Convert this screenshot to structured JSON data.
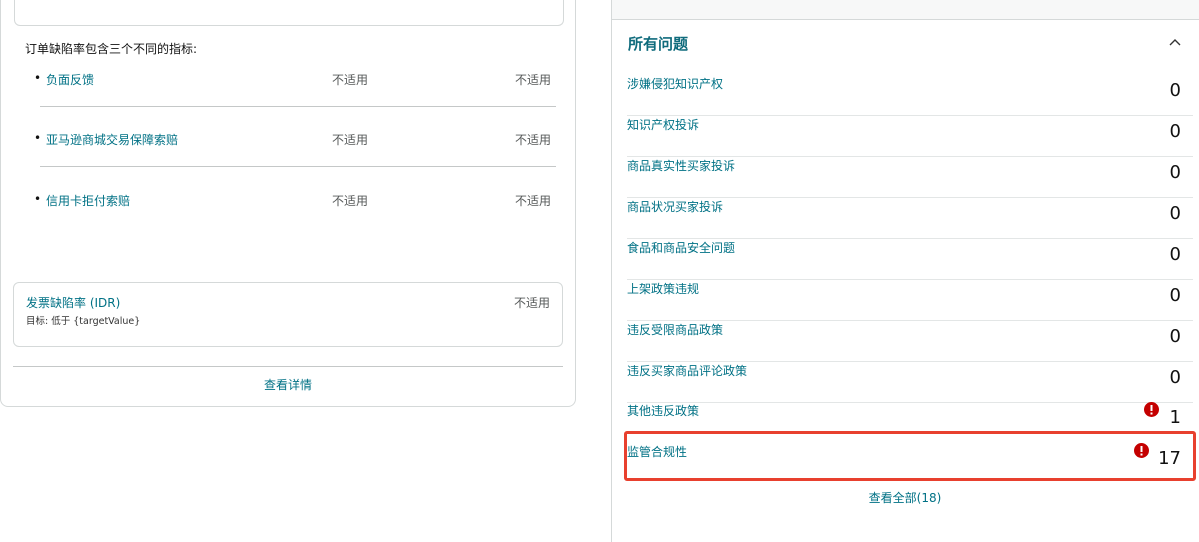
{
  "left": {
    "intro": "订单缺陷率包含三个不同的指标:",
    "metrics": [
      {
        "label": "负面反馈",
        "value1": "不适用",
        "value2": "不适用"
      },
      {
        "label": "亚马逊商城交易保障索赔",
        "value1": "不适用",
        "value2": "不适用"
      },
      {
        "label": "信用卡拒付索赔",
        "value1": "不适用",
        "value2": "不适用"
      }
    ],
    "idr": {
      "title": "发票缺陷率 (IDR)",
      "target": "目标: 低于 {targetValue}",
      "value": "不适用"
    },
    "view_details": "查看详情"
  },
  "right": {
    "title": "所有问题",
    "issues": [
      {
        "label": "涉嫌侵犯知识产权",
        "count": "0",
        "alert": false
      },
      {
        "label": "知识产权投诉",
        "count": "0",
        "alert": false
      },
      {
        "label": "商品真实性买家投诉",
        "count": "0",
        "alert": false
      },
      {
        "label": "商品状况买家投诉",
        "count": "0",
        "alert": false
      },
      {
        "label": "食品和商品安全问题",
        "count": "0",
        "alert": false
      },
      {
        "label": "上架政策违规",
        "count": "0",
        "alert": false
      },
      {
        "label": "违反受限商品政策",
        "count": "0",
        "alert": false
      },
      {
        "label": "违反买家商品评论政策",
        "count": "0",
        "alert": false
      },
      {
        "label": "其他违反政策",
        "count": "1",
        "alert": true
      },
      {
        "label": "监管合规性",
        "count": "17",
        "alert": true
      }
    ],
    "view_all": "查看全部(18)"
  },
  "colors": {
    "link": "#007185",
    "title": "#0f6b7c",
    "alert": "#c40000",
    "highlight": "#e8402e"
  }
}
